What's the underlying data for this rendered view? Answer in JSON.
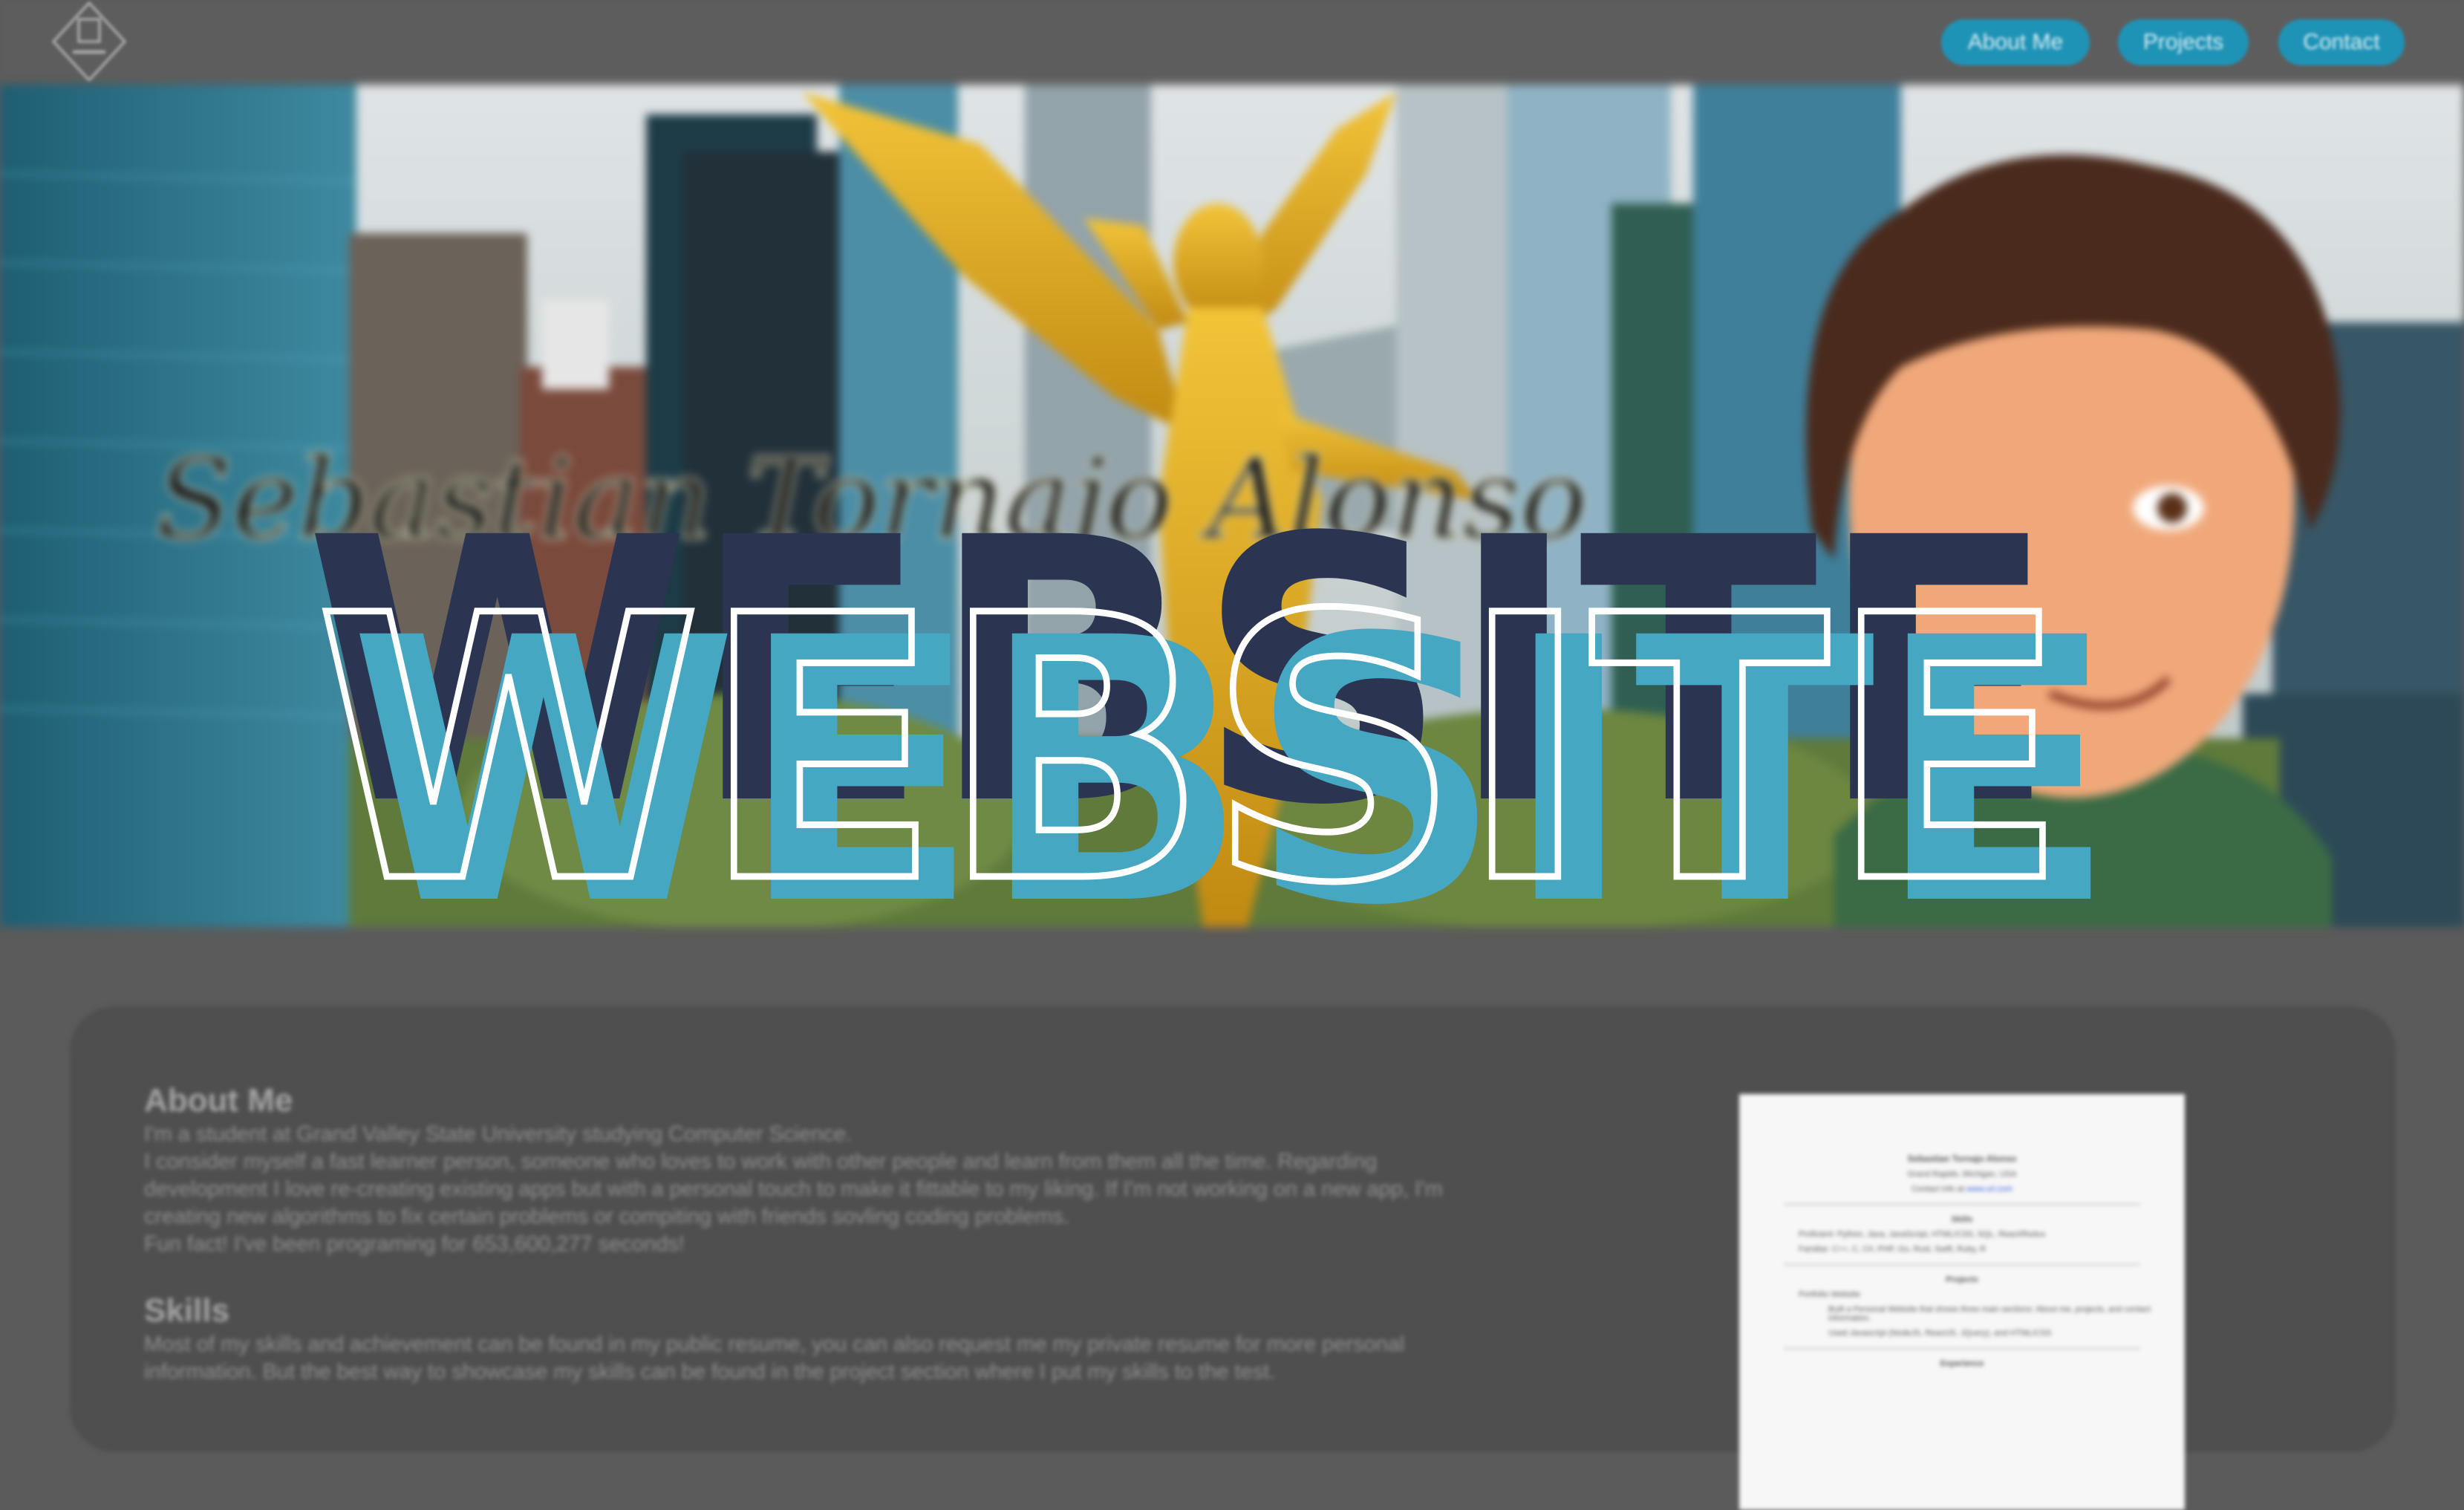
{
  "nav": {
    "links": [
      "About Me",
      "Projects",
      "Contact"
    ]
  },
  "hero": {
    "signature": "Sebastian Tornajo Alonso",
    "title": "WEBSITE"
  },
  "about": {
    "heading": "About Me",
    "lines": [
      "I'm a student at Grand Valley State University studying Computer Science.",
      "I consider myself a fast learner person, someone who loves to work with other people and learn from them all the time. Regarding",
      "development I love re-creating existing apps but with a personal touch to make it fittable to my liking. If I'm not working on a new app, I'm",
      "creating new algorithms to fix certain problems or compiting with friends sovling coding problems.",
      "Fun fact! I've been programing for 653,600,277 seconds!"
    ]
  },
  "skills": {
    "heading": "Skills",
    "lines": [
      "Most of my skills and achievement can be found in my public resume, you can also request me my private resume for more personal",
      "information. But the best way to showcase my skills can be found in the project section where I put my skills to the test."
    ]
  },
  "resume": {
    "name": "Sebastian Tornajo Alonso",
    "location": "Grand Rapids, Michigan, USA",
    "contact_prefix": "Contact info at",
    "contact_link": "www.url.com",
    "skills_title": "Skills",
    "skills": [
      "Proficient: Python, Java, JavaScript, HTML/CSS, SQL, React/Redux",
      "Familiar: C++, C, C#, PHP, Go, Rust, Swift, Ruby, R"
    ],
    "projects_title": "Projects",
    "projects": [
      "Portfolio Website",
      "Built a Personal Website that shows three main sections: About me, projects, and contact information.",
      "Used Javascript (NodeJS, ReactJS, JQuery), and HTML/CSS"
    ],
    "experience_title": "Experience"
  },
  "colors": {
    "nav_button": "#1f93b6",
    "title_fill": "#45a7c1",
    "title_shadow": "#2b3552",
    "title_outline": "#ffffff"
  }
}
